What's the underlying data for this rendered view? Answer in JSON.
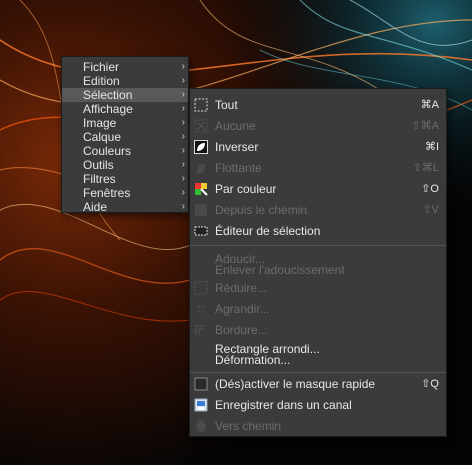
{
  "colors": {
    "menu_bg": "#3b3b3b",
    "menu_active": "#595959",
    "text": "#e6e6e6",
    "text_disabled": "#6c6c6c"
  },
  "main_menu": {
    "items": [
      {
        "label": "Fichier"
      },
      {
        "label": "Edition"
      },
      {
        "label": "Sélection",
        "active": true
      },
      {
        "label": "Affichage"
      },
      {
        "label": "Image"
      },
      {
        "label": "Calque"
      },
      {
        "label": "Couleurs"
      },
      {
        "label": "Outils"
      },
      {
        "label": "Filtres"
      },
      {
        "label": "Fenêtres"
      },
      {
        "label": "Aide"
      }
    ],
    "arrow": "›"
  },
  "submenu": {
    "tout": {
      "label": "Tout",
      "shortcut": "⌘A",
      "icon": "select-all-icon"
    },
    "aucune": {
      "label": "Aucune",
      "shortcut": "⇧⌘A",
      "icon": "select-none-icon"
    },
    "inverser": {
      "label": "Inverser",
      "shortcut": "⌘I",
      "icon": "invert-selection-icon"
    },
    "flottante": {
      "label": "Flottante",
      "shortcut": "⇧⌘L",
      "icon": "floating-selection-icon"
    },
    "par_couleur": {
      "label": "Par couleur",
      "shortcut": "⇧O",
      "icon": "select-by-color-icon"
    },
    "depuis_chemin": {
      "label": "Depuis le chemin",
      "shortcut": "⇧V",
      "icon": "from-path-icon"
    },
    "editeur": {
      "label": "Éditeur de sélection",
      "icon": "selection-editor-icon"
    },
    "adoucir": {
      "label": "Adoucir..."
    },
    "enlever": {
      "label": "Enlever l'adoucissement"
    },
    "reduire": {
      "label": "Réduire...",
      "icon": "shrink-icon"
    },
    "agrandir": {
      "label": "Agrandir...",
      "icon": "grow-icon"
    },
    "bordure": {
      "label": "Bordure...",
      "icon": "border-icon"
    },
    "rectangle": {
      "label": "Rectangle arrondi..."
    },
    "deformation": {
      "label": "Déformation..."
    },
    "masque": {
      "label": "(Dés)activer le masque rapide",
      "shortcut": "⇧Q",
      "icon": "quick-mask-icon"
    },
    "canal": {
      "label": "Enregistrer dans un canal",
      "icon": "save-to-channel-icon"
    },
    "vers_chemin": {
      "label": "Vers chemin",
      "icon": "to-path-icon"
    }
  }
}
